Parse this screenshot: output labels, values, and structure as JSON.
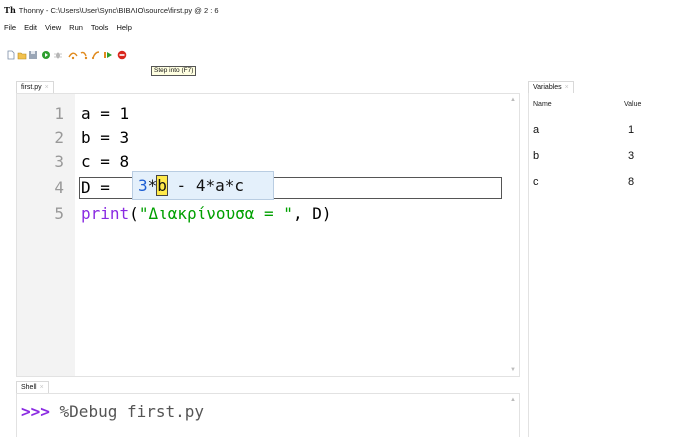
{
  "window": {
    "app_icon": "Th",
    "title": "Thonny  -  C:\\Users\\User\\Sync\\ΒΙΒΛΙΟ\\source\\first.py  @  2 : 6"
  },
  "menu": [
    "File",
    "Edit",
    "View",
    "Run",
    "Tools",
    "Help"
  ],
  "toolbar": {
    "tooltip": "Step into (F7)",
    "icons": [
      "new-file-icon",
      "open-folder-icon",
      "save-icon",
      "run-icon",
      "debug-icon",
      "step-over-icon",
      "step-into-icon",
      "step-out-icon",
      "resume-icon",
      "stop-icon"
    ],
    "colors": {
      "run": "#2e9e2e",
      "stop": "#d9261c",
      "step": "#e08a1e"
    }
  },
  "editor": {
    "tab_label": "first.py",
    "tab_close": "×",
    "lines": [
      {
        "num": "1",
        "text": "a = 1"
      },
      {
        "num": "2",
        "text": "b = 3"
      },
      {
        "num": "3",
        "text": "c = 8"
      },
      {
        "num": "4",
        "text": "D = "
      },
      {
        "num": "5",
        "print_kw": "print",
        "paren_open": "(",
        "string": "\"Διακρίνουσα = \"",
        "rest": ", D)"
      }
    ],
    "eval_box": {
      "num": "3",
      "op": "*",
      "highlight": "b",
      "rest": " - 4*a*c"
    }
  },
  "shell": {
    "tab_label": "Shell",
    "tab_close": "×",
    "prompt": ">>>",
    "command": " %Debug first.py"
  },
  "variables": {
    "tab_label": "Variables",
    "tab_close": "×",
    "headers": {
      "name": "Name",
      "value": "Value"
    },
    "rows": [
      {
        "name": "a",
        "value": "1"
      },
      {
        "name": "b",
        "value": "3"
      },
      {
        "name": "c",
        "value": "8"
      }
    ]
  }
}
